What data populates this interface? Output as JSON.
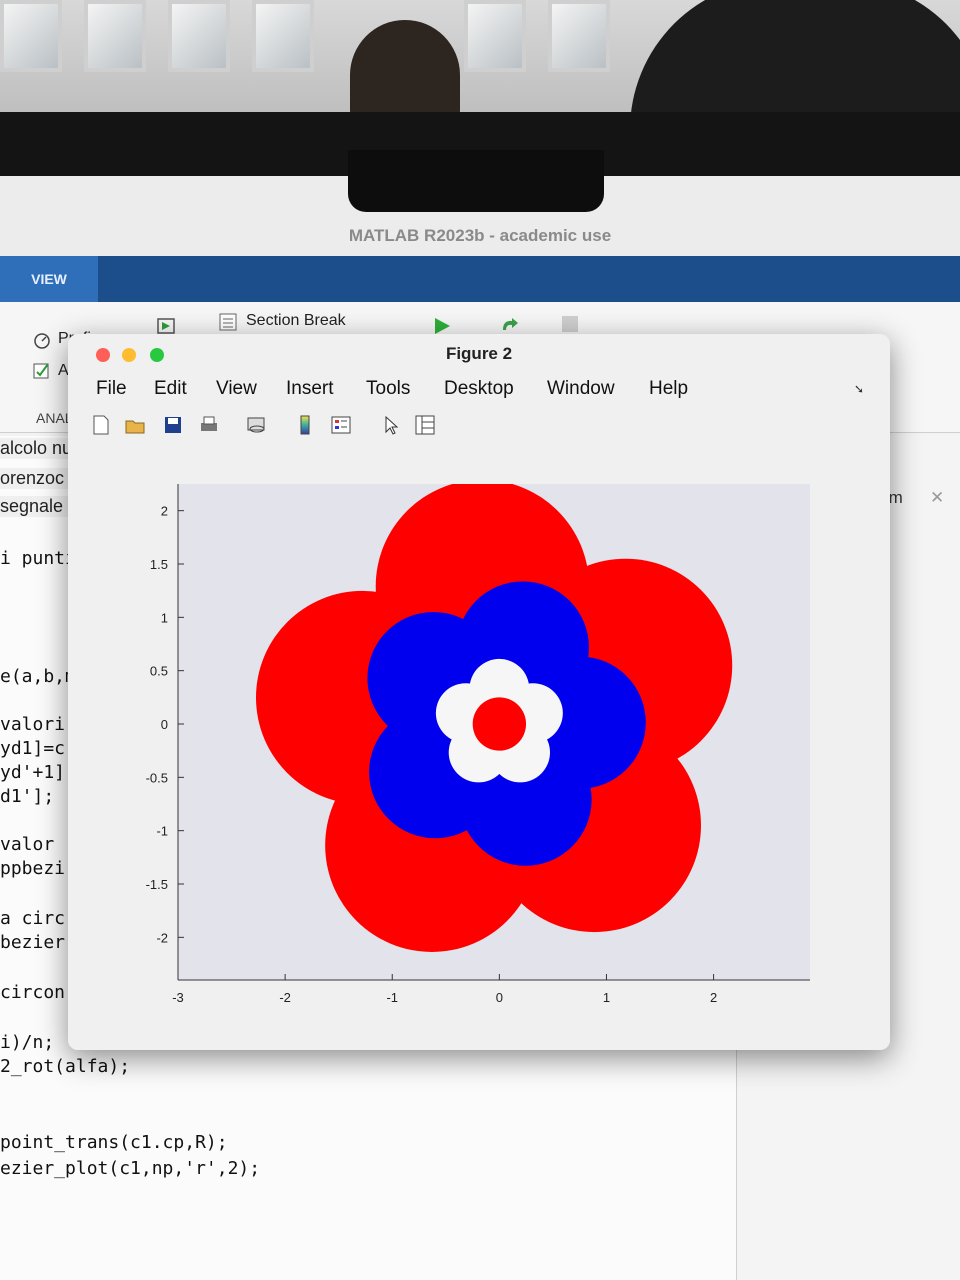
{
  "app_title": "MATLAB R2023b - academic use",
  "ribbon": {
    "active_tab": "VIEW",
    "section_break": "Section Break",
    "profile_label": "Profi",
    "analyze_label": "Ana",
    "analyze_group": "ANAL"
  },
  "editor": {
    "header_lines": [
      "alcolo nu",
      "orenzoc",
      "segnale"
    ],
    "code_lines": [
      "i punti",
      "e(a,b,m",
      "valori",
      "yd1]=c",
      "yd'+1];",
      "d1'];",
      " valor",
      "ppbezi",
      "a circ",
      "bezier",
      "circon",
      "i)/n;",
      "2_rot(alfa);",
      " point_trans(c1.cp,R);",
      "ezier_plot(c1,np,'r',2);"
    ],
    "right_tab": "ns.m"
  },
  "figure": {
    "title": "Figure 2",
    "menu": [
      "File",
      "Edit",
      "View",
      "Insert",
      "Tools",
      "Desktop",
      "Window",
      "Help"
    ],
    "toolbar_icons": [
      "new-figure-icon",
      "open-file-icon",
      "save-icon",
      "print-icon",
      "link-plot-icon",
      "colorbar-icon",
      "legend-icon",
      "edit-plot-arrow-icon",
      "property-inspector-icon"
    ]
  },
  "colors": {
    "outer_petals": "#ff0000",
    "middle_petals": "#0000ee",
    "inner_petals": "#f6f6f6",
    "center": "#ff0000",
    "axes_background": "#e3e3ec",
    "matlab_blue": "#1d4e8c"
  },
  "chart_data": {
    "type": "scatter",
    "xlim": [
      -3,
      2.9
    ],
    "ylim": [
      -2.4,
      2.25
    ],
    "xticks": [
      "-3",
      "-2",
      "-1",
      "0",
      "1",
      "2"
    ],
    "yticks": [
      "2",
      "1.5",
      "1",
      "0.5",
      "0",
      "-0.5",
      "-1",
      "-1.5",
      "-2"
    ],
    "xtick_values": [
      -3,
      -2,
      -1,
      0,
      1,
      2
    ],
    "ytick_values": [
      2,
      1.5,
      1,
      0.5,
      0,
      -0.5,
      -1,
      -1.5,
      -2
    ],
    "grid": false,
    "flower_layers": [
      {
        "name": "outer",
        "petals": 5,
        "petal_center_radius": 1.3,
        "petal_radius": 1.0,
        "start_angle_deg": 97,
        "core_radius": 1.3,
        "color": "#ff0000"
      },
      {
        "name": "middle",
        "petals": 5,
        "petal_center_radius": 0.75,
        "petal_radius": 0.62,
        "start_angle_deg": 73,
        "core_radius": 0.8,
        "color": "#0000ee"
      },
      {
        "name": "inner",
        "petals": 5,
        "petal_center_radius": 0.33,
        "petal_radius": 0.28,
        "start_angle_deg": 90,
        "core_radius": 0.35,
        "color": "#f6f6f6"
      },
      {
        "name": "center",
        "petals": 0,
        "core_radius": 0.25,
        "color": "#ff0000"
      }
    ]
  }
}
